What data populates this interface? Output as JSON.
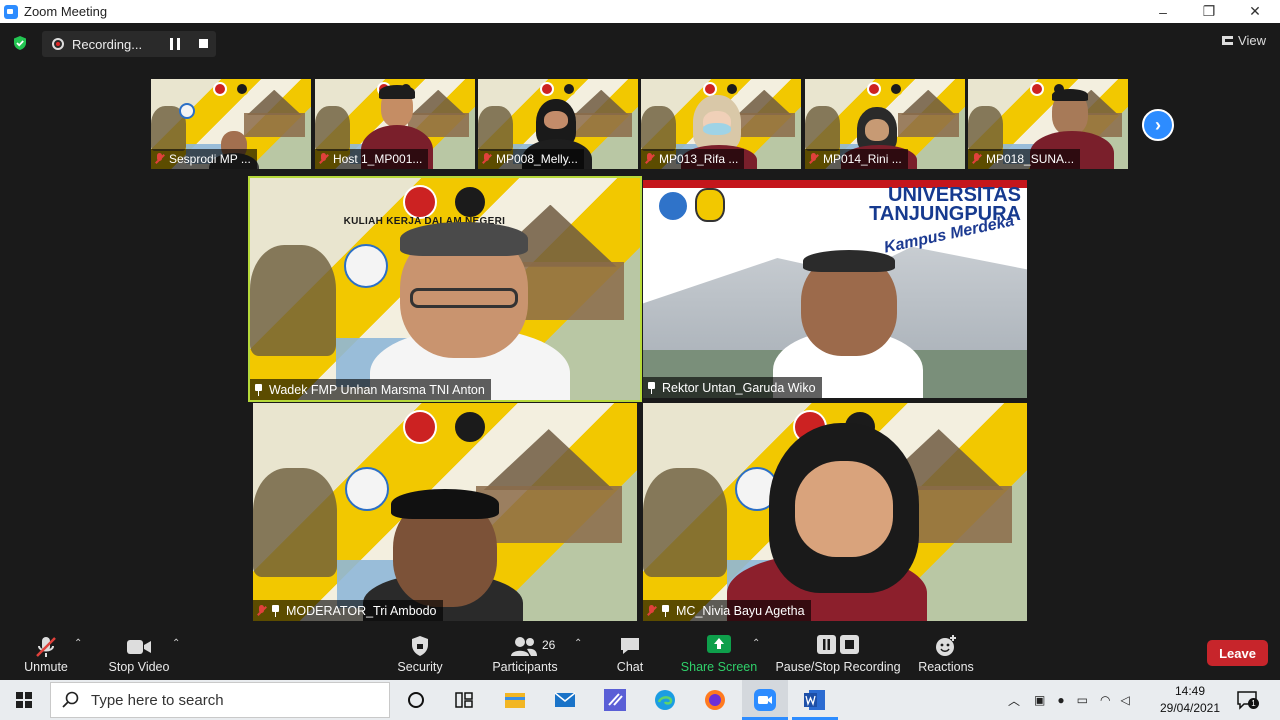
{
  "window": {
    "title": "Zoom Meeting",
    "controls": [
      "–",
      "❐",
      "✕"
    ]
  },
  "topbar": {
    "recording_label": "Recording...",
    "view_label": "View"
  },
  "thumbnails": [
    {
      "name": "Sesprodi MP ..."
    },
    {
      "name": "Host 1_MP001..."
    },
    {
      "name": "MP008_Melly..."
    },
    {
      "name": "MP013_Rifa ..."
    },
    {
      "name": "MP014_Rini ..."
    },
    {
      "name": "MP018_SUNA..."
    }
  ],
  "slide": {
    "banner": "KULIAH KERJA DALAM NEGERI"
  },
  "untan": {
    "line1": "UNIVERSITAS",
    "line2": "TANJUNGPURA",
    "tagline": "Kampus Merdeka"
  },
  "tiles": [
    {
      "name": "Wadek FMP Unhan Marsma TNI Anton"
    },
    {
      "name": "Rektor Untan_Garuda Wiko"
    },
    {
      "name": "MODERATOR_Tri Ambodo"
    },
    {
      "name": "MC_Nivia Bayu Agetha"
    }
  ],
  "controls": {
    "unmute": "Unmute",
    "stop_video": "Stop Video",
    "security": "Security",
    "participants": "Participants",
    "participants_count": "26",
    "chat": "Chat",
    "share_screen": "Share Screen",
    "pause_stop_recording": "Pause/Stop Recording",
    "reactions": "Reactions",
    "leave": "Leave"
  },
  "taskbar": {
    "search_placeholder": "Type here to search",
    "time": "14:49",
    "date": "29/04/2021",
    "notification_count": "1"
  },
  "colors": {
    "accent": "#2d8cff",
    "share": "#0e9f4b",
    "leave": "#c7252b",
    "active_border": "#b6d93a"
  }
}
